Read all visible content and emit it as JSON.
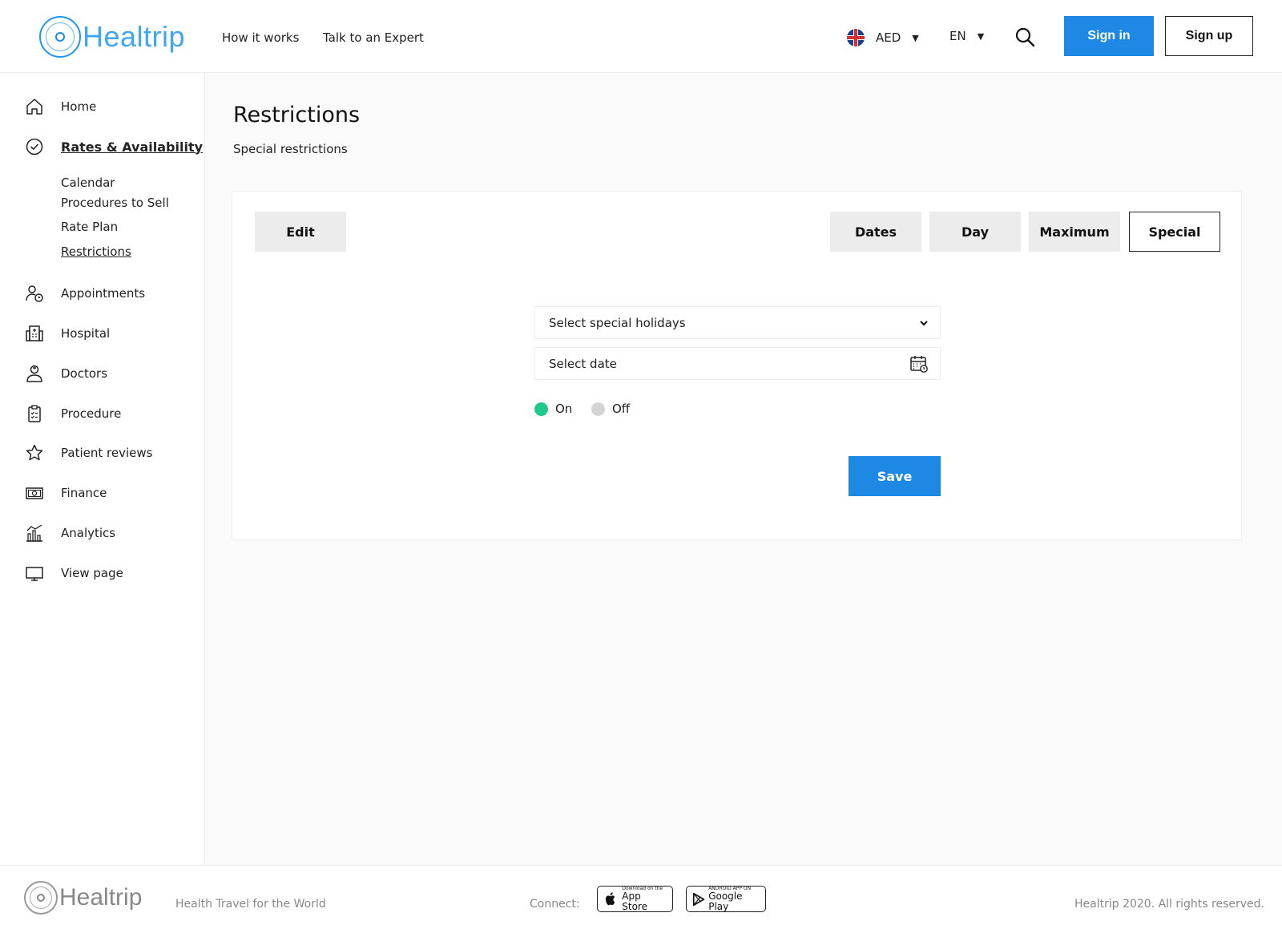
{
  "brand": {
    "name": "Healtrip",
    "accent": "#1e88e5"
  },
  "header": {
    "nav": [
      "How it works",
      "Talk to an Expert"
    ],
    "currency": "AED",
    "language": "EN",
    "sign_in": "Sign in",
    "sign_up": "Sign up"
  },
  "sidebar": {
    "items": [
      {
        "label": "Home",
        "icon": "home-icon"
      },
      {
        "label": "Rates & Availability",
        "icon": "check-circle-icon"
      },
      {
        "label": "Appointments",
        "icon": "user-clock-icon"
      },
      {
        "label": "Hospital",
        "icon": "building-icon"
      },
      {
        "label": "Doctors",
        "icon": "doctor-icon"
      },
      {
        "label": "Procedure",
        "icon": "clipboard-icon"
      },
      {
        "label": "Patient reviews",
        "icon": "star-icon"
      },
      {
        "label": "Finance",
        "icon": "cash-icon"
      },
      {
        "label": "Analytics",
        "icon": "chart-icon"
      },
      {
        "label": "View page",
        "icon": "monitor-icon"
      }
    ],
    "subitems": [
      "Calendar",
      "Procedures to Sell",
      "Rate Plan",
      "Restrictions"
    ]
  },
  "main": {
    "title": "Restrictions",
    "subtitle": "Special restrictions",
    "edit_tab": "Edit",
    "tabs": [
      "Dates",
      "Day",
      "Maximum",
      "Special"
    ],
    "active_tab": "Special",
    "holiday_select_placeholder": "Select special holidays",
    "date_placeholder": "Select date",
    "radio_on": "On",
    "radio_off": "Off",
    "radio_selected": "On",
    "save": "Save"
  },
  "footer": {
    "tagline": "Health Travel for the World",
    "connect": "Connect:",
    "app_store_small": "Download on the",
    "app_store_big": "App Store",
    "google_small": "ANDROID APP ON",
    "google_big": "Google Play",
    "copyright": "Healtrip 2020. All rights reserved."
  }
}
